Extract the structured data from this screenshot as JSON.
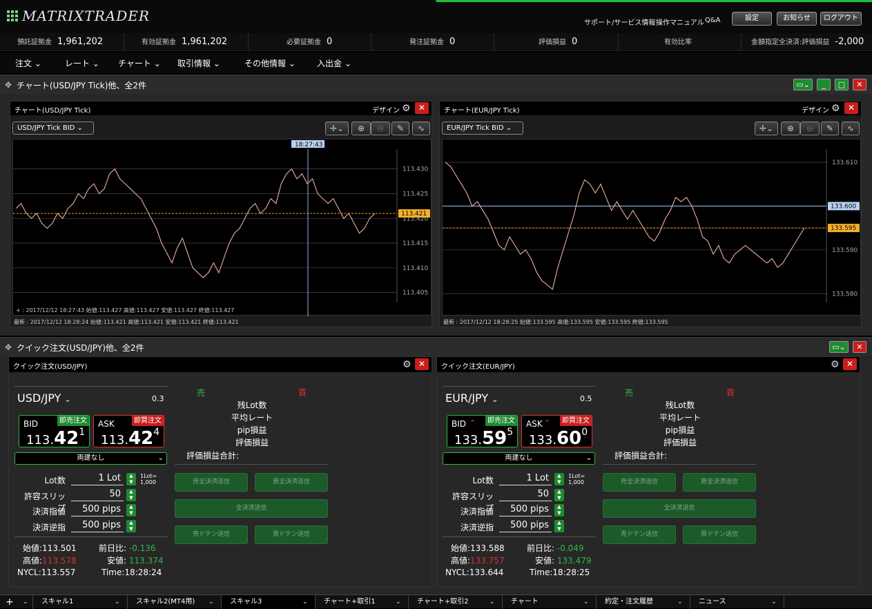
{
  "app": {
    "logo": "MATRIXTRADER",
    "links": [
      "サポート/サービス情報",
      "操作マニュアル",
      "Q&A"
    ],
    "buttons": [
      "設定",
      "お知らせ",
      "ログアウト"
    ]
  },
  "account": [
    {
      "label": "預託証拠金",
      "value": "1,961,202"
    },
    {
      "label": "有効証拠金",
      "value": "1,961,202"
    },
    {
      "label": "必要証拠金",
      "value": "0"
    },
    {
      "label": "発注証拠金",
      "value": "0"
    },
    {
      "label": "評価損益",
      "value": "0"
    },
    {
      "label": "有効比率",
      "value": ""
    },
    {
      "label": "金額指定全決済:評価損益",
      "value": "-2,000"
    }
  ],
  "menu": [
    "注文",
    "レート",
    "チャート",
    "取引情報",
    "その他情報",
    "入出金"
  ],
  "chart_panel": {
    "title": "チャート(USD/JPY Tick)他、全2件"
  },
  "charts": [
    {
      "title": "チャート(USD/JPY Tick)",
      "design": "デザイン",
      "symbol": "USD/JPY  Tick BID",
      "cursor_time": "18:27:43",
      "crosshair": "+ : 2017/12/12 18:27:43  始値:113.427  高値:113.427  安値:113.427  終値:113.427",
      "latest": "最新 : 2017/12/12 18:28:24  始値:113.421  高値:113.421  安値:113.421  終値:113.421",
      "ticks": [
        "113.430",
        "113.425",
        "113.420",
        "113.415",
        "113.410",
        "113.405"
      ],
      "current": "113.421"
    },
    {
      "title": "チャート(EUR/JPY Tick)",
      "design": "デザイン",
      "symbol": "EUR/JPY  Tick BID",
      "latest": "最新 : 2017/12/12 18:28:25  始値:133.595  高値:133.595  安値:133.595  終値:133.595",
      "ticks": [
        "133.610",
        "133.600",
        "133.595",
        "133.590",
        "133.580"
      ],
      "current": "133.595",
      "line": "133.600"
    }
  ],
  "chart_data": [
    {
      "type": "line",
      "title": "チャート(USD/JPY Tick)",
      "ylim": [
        113.403,
        113.434
      ],
      "y": [
        113.422,
        113.423,
        113.421,
        113.42,
        113.421,
        113.419,
        113.418,
        113.419,
        113.421,
        113.42,
        113.422,
        113.423,
        113.425,
        113.424,
        113.426,
        113.427,
        113.425,
        113.426,
        113.429,
        113.43,
        113.428,
        113.427,
        113.426,
        113.425,
        113.424,
        113.422,
        113.42,
        113.418,
        113.415,
        113.413,
        113.411,
        113.414,
        113.416,
        113.413,
        113.41,
        113.409,
        113.408,
        113.409,
        113.411,
        113.409,
        113.412,
        113.415,
        113.417,
        113.418,
        113.42,
        113.422,
        113.423,
        113.421,
        113.422,
        113.424,
        113.423,
        113.427,
        113.429,
        113.43,
        113.428,
        113.429,
        113.427,
        113.428,
        113.425,
        113.424,
        113.423,
        113.424,
        113.422,
        113.42,
        113.421,
        113.419,
        113.417,
        113.418,
        113.42,
        113.421
      ]
    },
    {
      "type": "line",
      "title": "チャート(EUR/JPY Tick)",
      "ylim": [
        133.578,
        133.613
      ],
      "y": [
        133.61,
        133.609,
        133.607,
        133.605,
        133.603,
        133.6,
        133.601,
        133.599,
        133.597,
        133.594,
        133.591,
        133.59,
        133.593,
        133.591,
        133.589,
        133.59,
        133.588,
        133.585,
        133.583,
        133.582,
        133.581,
        133.586,
        133.59,
        133.594,
        133.598,
        133.603,
        133.606,
        133.605,
        133.603,
        133.605,
        133.602,
        133.599,
        133.601,
        133.599,
        133.597,
        133.599,
        133.597,
        133.595,
        133.593,
        133.592,
        133.594,
        133.597,
        133.599,
        133.602,
        133.601,
        133.602,
        133.6,
        133.597,
        133.593,
        133.592,
        133.589,
        133.591,
        133.588,
        133.587,
        133.589,
        133.59,
        133.591,
        133.59,
        133.589,
        133.588,
        133.587,
        133.588,
        133.586,
        133.587,
        133.589,
        133.591,
        133.593,
        133.595
      ]
    }
  ],
  "quick_panel": {
    "title": "クイック注文(USD/JPY)他、全2件"
  },
  "quick": [
    {
      "title": "クイック注文(USD/JPY)",
      "pair": "USD/JPY",
      "lot": "0.3",
      "bid_label": "BID",
      "ask_label": "ASK",
      "sell_tag": "即売注文",
      "buy_tag": "即買注文",
      "bid": {
        "head": "113.",
        "big": "42",
        "tail": "1"
      },
      "ask": {
        "head": "113.",
        "big": "42",
        "tail": "4"
      },
      "mode": "両建なし",
      "fields": [
        {
          "label": "Lot数",
          "value": "1 Lot"
        },
        {
          "label": "許容スリップ",
          "value": "50"
        },
        {
          "label": "決済指値",
          "value": "500 pips"
        },
        {
          "label": "決済逆指",
          "value": "500 pips"
        }
      ],
      "lotnote": "1Lot=\n1,000",
      "sell": "売",
      "buy": "買",
      "rows": [
        "残Lot数",
        "平均レート",
        "pip損益",
        "評価損益"
      ],
      "total": "評価損益合計:",
      "btns": [
        "売全決済送信",
        "買全決済送信",
        "全決済送信",
        "売ドテン送信",
        "買ドテン送信"
      ],
      "stats": {
        "open_l": "始値:",
        "open": "113.501",
        "prev_l": "前日比:",
        "prev": "-0.136",
        "high_l": "高値:",
        "high": "113.578",
        "low_l": "安値:",
        "low": "113.374",
        "nycl_l": "NYCL:",
        "nycl": "113.557",
        "time_l": "Time:",
        "time": "18:28:24"
      }
    },
    {
      "title": "クイック注文(EUR/JPY)",
      "pair": "EUR/JPY",
      "lot": "0.5",
      "bid_label": "BID",
      "ask_label": "ASK",
      "sell_tag": "即売注文",
      "buy_tag": "即買注文",
      "bid": {
        "head": "133.",
        "big": "59",
        "tail": "5"
      },
      "ask": {
        "head": "133.",
        "big": "60",
        "tail": "0"
      },
      "mode": "両建なし",
      "fields": [
        {
          "label": "Lot数",
          "value": "1 Lot"
        },
        {
          "label": "許容スリップ",
          "value": "50"
        },
        {
          "label": "決済指値",
          "value": "500 pips"
        },
        {
          "label": "決済逆指",
          "value": "500 pips"
        }
      ],
      "lotnote": "1Lot=\n1,000",
      "sell": "売",
      "buy": "買",
      "rows": [
        "残Lot数",
        "平均レート",
        "pip損益",
        "評価損益"
      ],
      "total": "評価損益合計:",
      "btns": [
        "売全決済送信",
        "買全決済送信",
        "全決済送信",
        "売ドテン送信",
        "買ドテン送信"
      ],
      "stats": {
        "open_l": "始値:",
        "open": "133.588",
        "prev_l": "前日比:",
        "prev": "-0.049",
        "high_l": "高値:",
        "high": "133.757",
        "low_l": "安値:",
        "low": "133.479",
        "nycl_l": "NYCL:",
        "nycl": "133.644",
        "time_l": "Time:",
        "time": "18:28:25"
      }
    }
  ],
  "tabs": [
    "スキャル1",
    "スキャル2(MT4用)",
    "スキャル3",
    "チャート+取引1",
    "チャート+取引2",
    "チャート",
    "約定・注文履歴",
    "ニュース"
  ],
  "colors": {
    "up": "#2fb84a",
    "down": "#e03030",
    "line": "#f0b0a0"
  }
}
